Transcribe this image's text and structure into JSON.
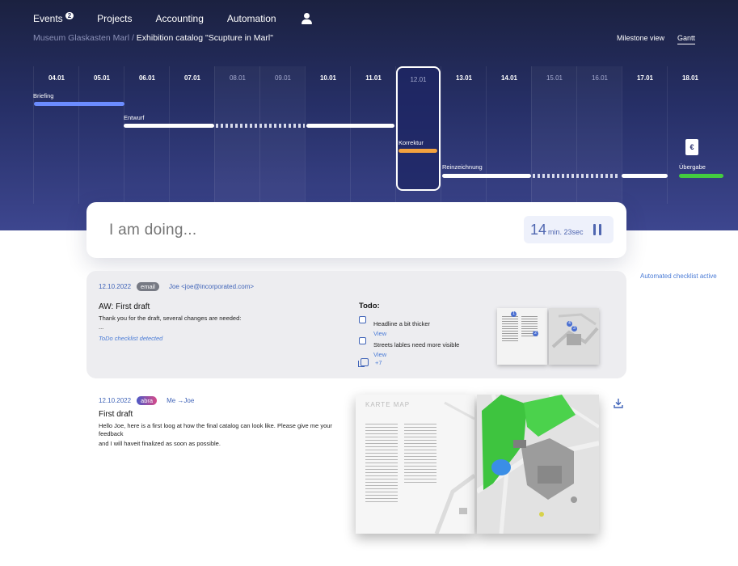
{
  "nav": {
    "items": [
      {
        "label": "Events",
        "badge": "2"
      },
      {
        "label": "Projects"
      },
      {
        "label": "Accounting"
      },
      {
        "label": "Automation"
      }
    ]
  },
  "breadcrumb": {
    "parent": "Museum Glaskasten Marl /",
    "current": "Exhibition catalog \"Scupture in Marl\""
  },
  "view_switch": {
    "milestone": "Milestone view",
    "gantt": "Gantt"
  },
  "timeline": {
    "days": [
      {
        "label": "04.01",
        "weekend": false
      },
      {
        "label": "05.01",
        "weekend": false
      },
      {
        "label": "06.01",
        "weekend": false
      },
      {
        "label": "07.01",
        "weekend": false
      },
      {
        "label": "08.01",
        "weekend": true
      },
      {
        "label": "09.01",
        "weekend": true
      },
      {
        "label": "10.01",
        "weekend": false
      },
      {
        "label": "11.01",
        "weekend": false
      },
      {
        "label": "12.01",
        "weekend": false,
        "today": true
      },
      {
        "label": "13.01",
        "weekend": false
      },
      {
        "label": "14.01",
        "weekend": false
      },
      {
        "label": "15.01",
        "weekend": true
      },
      {
        "label": "16.01",
        "weekend": true
      },
      {
        "label": "17.01",
        "weekend": false
      },
      {
        "label": "18.01",
        "weekend": false
      }
    ],
    "tasks": {
      "briefing": "Briefing",
      "entwurf": "Entwurf",
      "korrektur": "Korrektur",
      "reinzeichnung": "Reinzeichnung",
      "uebergabe": "Übergabe"
    },
    "handover_icon_glyph": "€"
  },
  "doing": {
    "placeholder": "I am doing...",
    "timer_min": "14",
    "timer_unit": "min. 23sec"
  },
  "automated_checklist": "Automated checklist active",
  "email1": {
    "date": "12.10.2022",
    "tag": "email",
    "from": "Joe <joe@incorporated.com>",
    "subject": "AW: First draft",
    "body": "Thank you for the draft, several changes are needed:",
    "ellipsis": "...",
    "detected": "ToDo checklist detected",
    "todo_title": "Todo:",
    "todos": [
      {
        "text": "Headline a bit thicker",
        "link": "View"
      },
      {
        "text": "Streets lables need more visible",
        "link": "View"
      }
    ],
    "more": "+7"
  },
  "email2": {
    "date": "12.10.2022",
    "tag": "abra",
    "from": "Me →Joe",
    "subject": "First draft",
    "body_line1": "Hello Joe, here is a first loog at how the final catalog can look like. Please give me your feedback",
    "body_line2": "and I will haveit finalized as soon as possible.",
    "booklet_title": "KARTE MAP"
  },
  "colors": {
    "accent": "#4064b8",
    "briefing": "#6b8cff",
    "korrektur": "#f3a23f",
    "uebergabe": "#43cc3f"
  }
}
